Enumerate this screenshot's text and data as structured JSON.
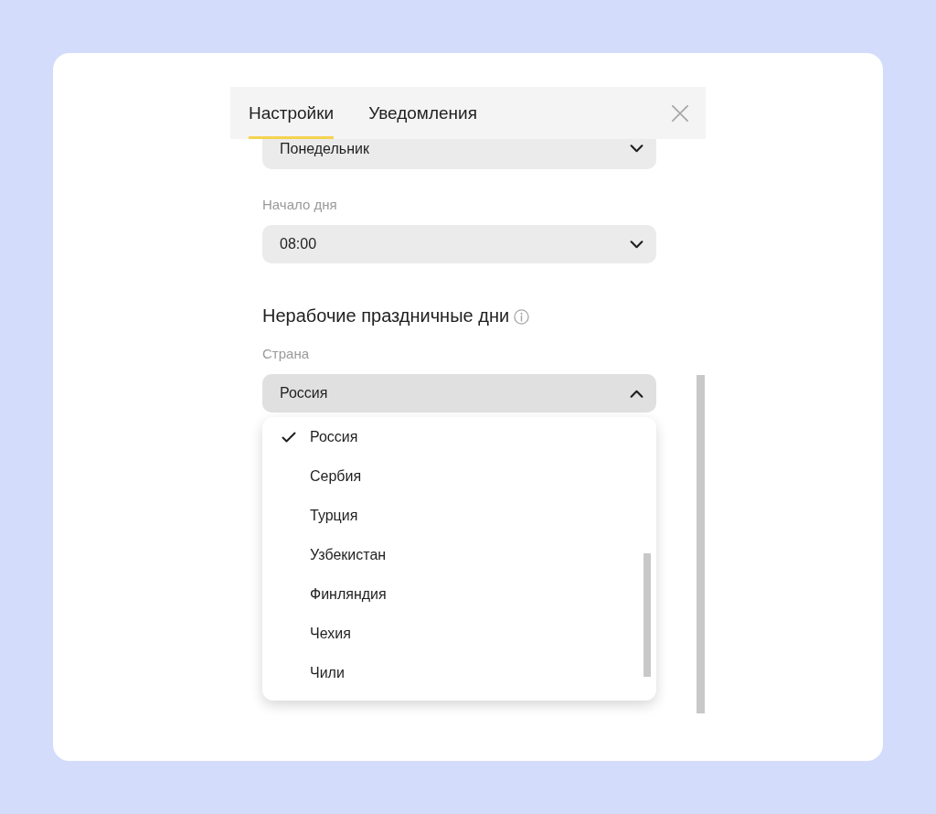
{
  "tabs": [
    {
      "label": "Настройки",
      "selected": true
    },
    {
      "label": "Уведомления",
      "selected": false
    }
  ],
  "settings": [
    {
      "kind": "select",
      "value": "Понедельник",
      "expanded": false
    },
    {
      "kind": "select",
      "label": "Начало дня",
      "value": "08:00",
      "expanded": false
    },
    {
      "kind": "heading",
      "title": "Нерабочие праздничные дни"
    },
    {
      "kind": "select",
      "label": "Страна",
      "value": "Россия",
      "expanded": true,
      "options": [
        {
          "label": "Россия",
          "selected": true
        },
        {
          "label": "Сербия",
          "selected": false
        },
        {
          "label": "Турция",
          "selected": false
        },
        {
          "label": "Узбекистан",
          "selected": false
        },
        {
          "label": "Финляндия",
          "selected": false
        },
        {
          "label": "Чехия",
          "selected": false
        },
        {
          "label": "Чили",
          "selected": false
        }
      ]
    }
  ]
}
